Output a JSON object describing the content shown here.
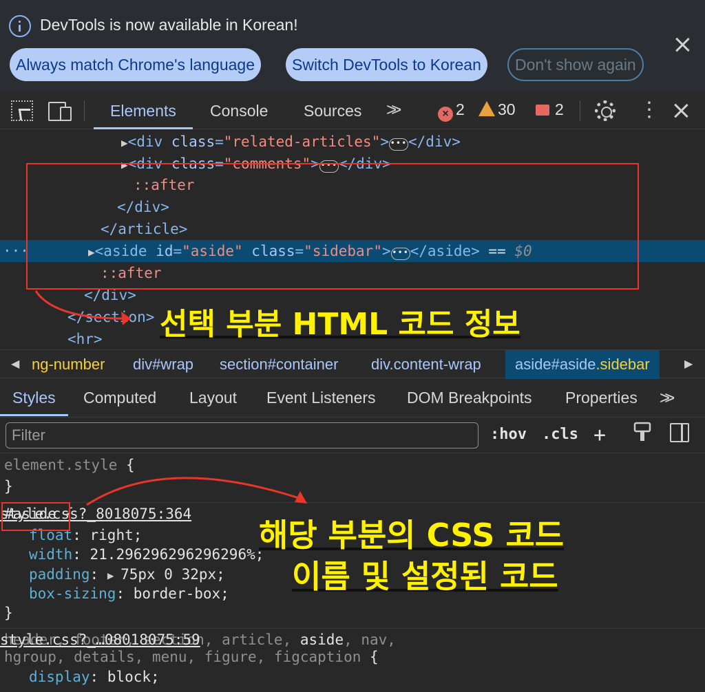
{
  "notice": {
    "message": "DevTools is now available in Korean!",
    "btn_match": "Always match Chrome's language",
    "btn_switch": "Switch DevTools to Korean",
    "btn_dont": "Don't show again"
  },
  "toolbar": {
    "tabs": [
      "Elements",
      "Console",
      "Sources"
    ],
    "errors": "2",
    "warnings": "30",
    "issues": "2"
  },
  "dom": {
    "l1_tag": "div",
    "l1_attr": "class",
    "l1_val": "\"related-articles\"",
    "l2_tag": "div",
    "l2_attr": "class",
    "l2_val": "\"comments\"",
    "l3_pseudo": "::after",
    "l4_close": "</div>",
    "l5_close": "</article>",
    "l6_tag": "aside",
    "l6_attr1": "id",
    "l6_val1": "\"aside\"",
    "l6_attr2": "class",
    "l6_val2": "\"sidebar\"",
    "l6_close": "</aside>",
    "l6_eq": " == ",
    "l6_dollar": "$0",
    "l7_pseudo": "::after",
    "l8_close": "</div>",
    "l9_close": "</section>",
    "l10_open": "<hr>"
  },
  "annotations": {
    "html_label": "선택 부분 HTML 코드 정보",
    "css_label_1": "해당 부분의 CSS 코드",
    "css_label_2": "이름 및 설정된 코드"
  },
  "breadcrumb": {
    "c1": "ng-number",
    "c2_tag": "div",
    "c2_id": "#wrap",
    "c3_tag": "section",
    "c3_id": "#container",
    "c4_tag": "div",
    "c4_cls": ".content-wrap",
    "c5_tag": "aside",
    "c5_id": "#aside",
    "c5_cls": ".sidebar"
  },
  "styles_tabs": [
    "Styles",
    "Computed",
    "Layout",
    "Event Listeners",
    "DOM Breakpoints",
    "Properties"
  ],
  "filter": {
    "placeholder": "Filter",
    "hov": ":hov",
    "cls": ".cls"
  },
  "css": {
    "element_style": "element.style",
    "rule1": {
      "selector": "#aside",
      "source": "style.css?_8018075:364",
      "props": [
        {
          "name": "float",
          "value": "right"
        },
        {
          "name": "width",
          "value": "21.296296296296296%"
        },
        {
          "name": "padding",
          "value": "75px 0 32px"
        },
        {
          "name": "box-sizing",
          "value": "border-box"
        }
      ]
    },
    "rule2": {
      "selector_a": "header, footer, section, article, ",
      "selector_match": "aside",
      "selector_b": ", nav,",
      "selector_line2": "hgroup, details, menu, figure, figcaption",
      "source": "style.css?_…08018075:59",
      "prop_name": "display",
      "prop_value": "block"
    }
  }
}
